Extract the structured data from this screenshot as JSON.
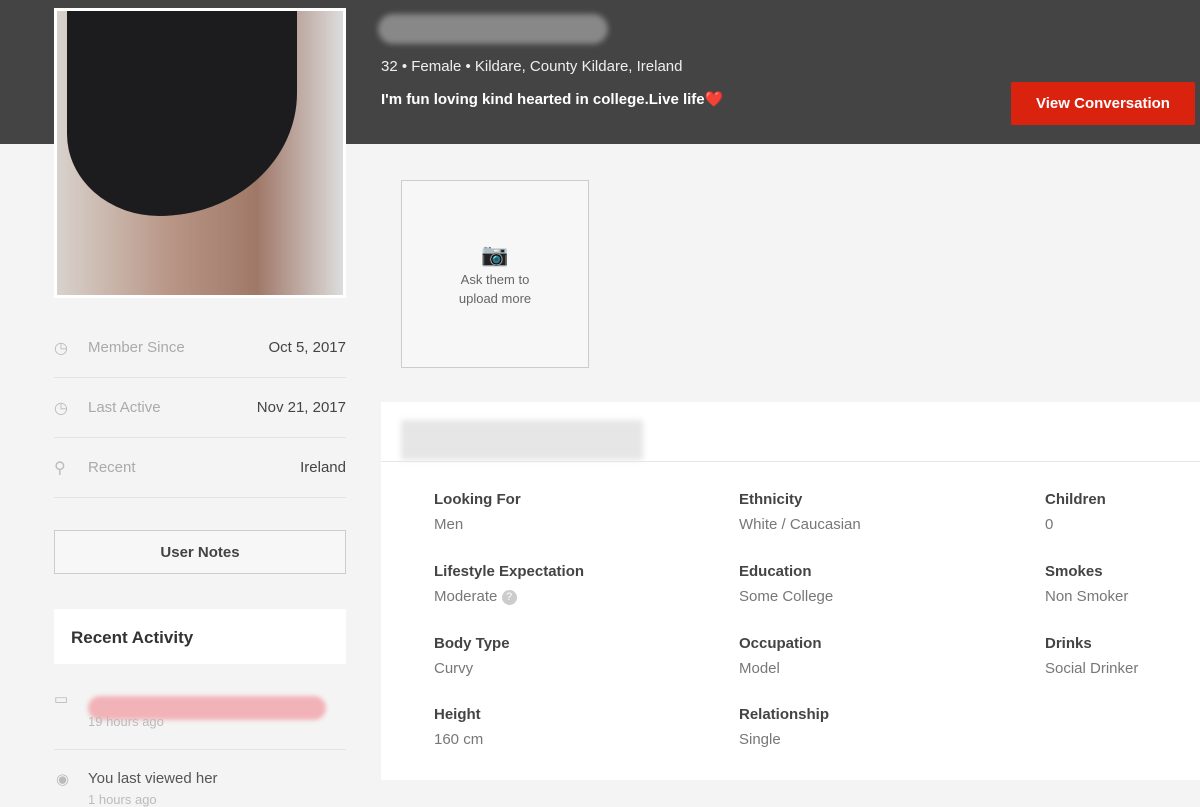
{
  "profile": {
    "meta": "32 • Female • Kildare, County Kildare, Ireland",
    "tagline": "I'm fun loving kind hearted in college.Live life",
    "tagline_emoji": "❤️",
    "view_conversation": "View Conversation"
  },
  "upload": {
    "text_line1": "Ask them to",
    "text_line2": "upload more",
    "icon": "camera-add-icon"
  },
  "stats": [
    {
      "icon": "clock-icon",
      "label": "Member Since",
      "value": "Oct 5, 2017"
    },
    {
      "icon": "clock-icon",
      "label": "Last Active",
      "value": "Nov 21, 2017"
    },
    {
      "icon": "location-pin-icon",
      "label": "Recent",
      "value": "Ireland"
    }
  ],
  "user_notes": "User Notes",
  "recent_activity": {
    "title": "Recent Activity",
    "items": [
      {
        "icon": "message-icon",
        "time": "19 hours ago"
      },
      {
        "icon": "eye-icon",
        "text": "You last viewed her",
        "time": "1 hours ago"
      }
    ]
  },
  "details": [
    {
      "key": "Looking For",
      "value": "Men"
    },
    {
      "key": "Ethnicity",
      "value": "White / Caucasian"
    },
    {
      "key": "Children",
      "value": "0"
    },
    {
      "key": "Lifestyle Expectation",
      "value": "Moderate"
    },
    {
      "key": "Education",
      "value": "Some College"
    },
    {
      "key": "Smokes",
      "value": "Non Smoker"
    },
    {
      "key": "Body Type",
      "value": "Curvy"
    },
    {
      "key": "Occupation",
      "value": "Model"
    },
    {
      "key": "Drinks",
      "value": "Social Drinker"
    },
    {
      "key": "Height",
      "value": "160 cm"
    },
    {
      "key": "Relationship",
      "value": "Single"
    }
  ],
  "colors": {
    "header": "#444444",
    "accent": "#d9230f"
  }
}
